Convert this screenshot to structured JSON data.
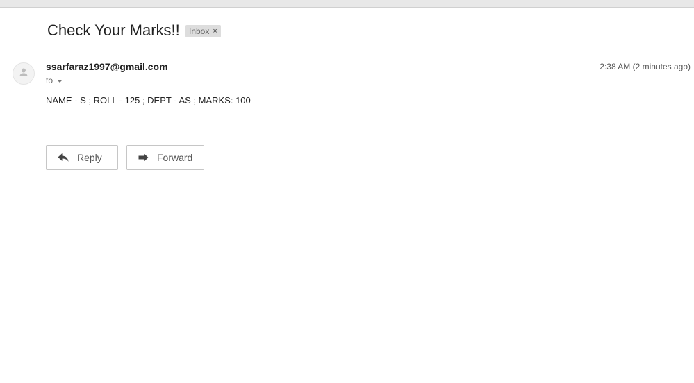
{
  "message": {
    "subject": "Check Your Marks!!",
    "label": "Inbox",
    "label_remove": "×",
    "sender": "ssarfaraz1997@gmail.com",
    "timestamp": "2:38 AM (2 minutes ago)",
    "to_label": "to",
    "body": "NAME - S ; ROLL - 125 ; DEPT - AS ; MARKS: 100"
  },
  "actions": {
    "reply_label": "Reply",
    "forward_label": "Forward"
  },
  "icons": {
    "avatar": "person-icon",
    "to_dropdown": "chevron-down-icon",
    "reply": "reply-arrow-icon",
    "forward": "forward-arrow-icon"
  }
}
